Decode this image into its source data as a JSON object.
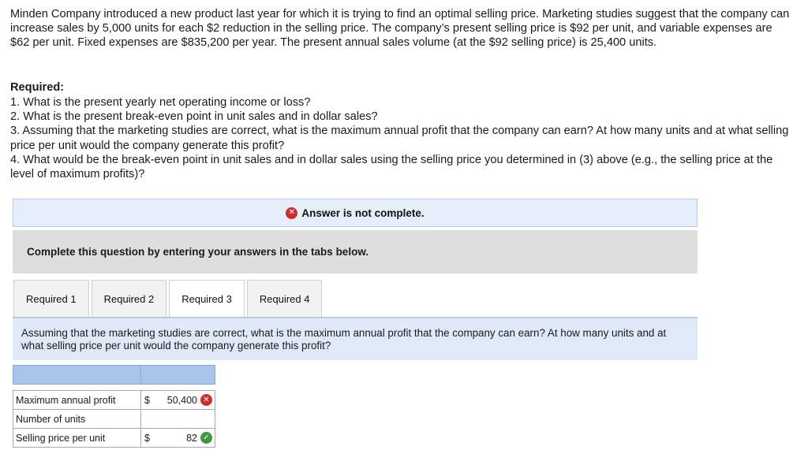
{
  "intro": "Minden Company introduced a new product last year for which it is trying to find an optimal selling price. Marketing studies suggest that the company can increase sales by 5,000 units for each $2 reduction in the selling price. The company’s present selling price is $92 per unit, and variable expenses are $62 per unit. Fixed expenses are $835,200 per year. The present annual sales volume (at the $92 selling price) is 25,400 units.",
  "required_heading": "Required:",
  "requirements": [
    "1. What is the present yearly net operating income or loss?",
    "2. What is the present break-even point in unit sales and in dollar sales?",
    "3. Assuming that the marketing studies are correct, what is the maximum annual profit that the company can earn? At how many units and at what selling price per unit would the company generate this profit?",
    "4. What would be the break-even point in unit sales and in dollar sales using the selling price you determined in (3) above (e.g., the selling price at the level of maximum profits)?"
  ],
  "status": {
    "text": "Answer is not complete.",
    "icon": "x-icon",
    "color": "#c9302c"
  },
  "instruction": "Complete this question by entering your answers in the tabs below.",
  "tabs": [
    {
      "label": "Required 1"
    },
    {
      "label": "Required 2"
    },
    {
      "label": "Required 3"
    },
    {
      "label": "Required 4"
    }
  ],
  "active_tab": "Required 3",
  "prompt": "Assuming that the marketing studies are correct, what is the maximum annual profit that the company can earn? At how many units and at what selling price per unit would the company generate this profit?",
  "answers": {
    "rows": [
      {
        "label": "Maximum annual profit",
        "currency": "$",
        "value": "50,400",
        "status": "incorrect"
      },
      {
        "label": "Number of units",
        "currency": "",
        "value": "",
        "status": ""
      },
      {
        "label": "Selling price per unit",
        "currency": "$",
        "value": "82",
        "status": "correct"
      }
    ],
    "icons": {
      "incorrect": "x-icon",
      "correct": "check-icon"
    },
    "colors": {
      "incorrect": "#c9302c",
      "correct": "#3c9a3c"
    }
  }
}
